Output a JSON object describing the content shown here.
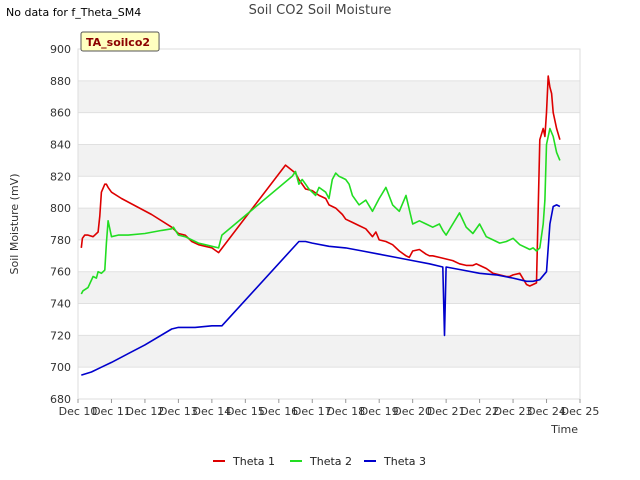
{
  "note": "No data for f_Theta_SM4",
  "chart_data": {
    "type": "line",
    "title": "Soil CO2 Soil Moisture",
    "xlabel": "Time",
    "ylabel": "Soil Moisture (mV)",
    "badge": "TA_soilco2",
    "xlim": [
      10,
      25
    ],
    "ylim": [
      680,
      900
    ],
    "x_ticks": [
      10,
      11,
      12,
      13,
      14,
      15,
      16,
      17,
      18,
      19,
      20,
      21,
      22,
      23,
      24,
      25
    ],
    "x_tick_labels": [
      "Dec 10",
      "Dec 11",
      "Dec 12",
      "Dec 13",
      "Dec 14",
      "Dec 15",
      "Dec 16",
      "Dec 17",
      "Dec 18",
      "Dec 19",
      "Dec 20",
      "Dec 21",
      "Dec 22",
      "Dec 23",
      "Dec 24",
      "Dec 25"
    ],
    "y_ticks": [
      680,
      700,
      720,
      740,
      760,
      780,
      800,
      820,
      840,
      860,
      880,
      900
    ],
    "y_tick_labels": [
      "680",
      "700",
      "720",
      "740",
      "760",
      "780",
      "800",
      "820",
      "840",
      "860",
      "880",
      "900"
    ],
    "grid": true,
    "legend_position": "bottom",
    "series": [
      {
        "name": "Theta 1",
        "color": "#dd0000",
        "x": [
          10.1,
          10.13,
          10.2,
          10.3,
          10.45,
          10.6,
          10.65,
          10.7,
          10.8,
          10.85,
          10.9,
          11.0,
          11.3,
          12.2,
          12.8,
          13.0,
          13.2,
          13.4,
          13.6,
          13.8,
          14.0,
          14.2,
          16.2,
          16.5,
          16.6,
          16.8,
          17.0,
          17.2,
          17.4,
          17.5,
          17.7,
          17.9,
          18.0,
          18.2,
          18.4,
          18.6,
          18.8,
          18.9,
          19.0,
          19.2,
          19.4,
          19.6,
          19.8,
          19.9,
          20.0,
          20.2,
          20.4,
          20.5,
          20.6,
          20.8,
          21.0,
          21.2,
          21.4,
          21.6,
          21.8,
          21.9,
          22.0,
          22.2,
          22.4,
          22.6,
          22.8,
          22.9,
          23.0,
          23.2,
          23.4,
          23.5,
          23.6,
          23.7,
          23.8,
          23.9,
          23.95,
          24.0,
          24.05,
          24.1,
          24.15,
          24.2,
          24.3,
          24.4
        ],
        "y": [
          775,
          781,
          783,
          783,
          782,
          785,
          795,
          810,
          815,
          815,
          813,
          810,
          806,
          796,
          788,
          784,
          783,
          779,
          777,
          776,
          775,
          772,
          827,
          822,
          818,
          812,
          811,
          808,
          806,
          802,
          800,
          796,
          793,
          791,
          789,
          787,
          782,
          785,
          780,
          779,
          777,
          773,
          770,
          769,
          773,
          774,
          771,
          770,
          770,
          769,
          768,
          767,
          765,
          764,
          764,
          765,
          764,
          762,
          759,
          758,
          757,
          757,
          758,
          759,
          752,
          751,
          752,
          753,
          843,
          850,
          845,
          860,
          883,
          876,
          872,
          860,
          850,
          843
        ]
      },
      {
        "name": "Theta 2",
        "color": "#22dd22",
        "x": [
          10.1,
          10.15,
          10.3,
          10.45,
          10.55,
          10.6,
          10.7,
          10.8,
          10.85,
          10.9,
          11.0,
          11.2,
          11.5,
          12.0,
          12.5,
          12.8,
          12.85,
          13.0,
          13.2,
          13.4,
          13.6,
          13.8,
          14.0,
          14.2,
          14.3,
          16.4,
          16.5,
          16.6,
          16.7,
          16.8,
          16.9,
          17.0,
          17.1,
          17.2,
          17.4,
          17.5,
          17.6,
          17.7,
          17.8,
          17.9,
          18.0,
          18.1,
          18.2,
          18.4,
          18.6,
          18.8,
          19.0,
          19.2,
          19.4,
          19.6,
          19.8,
          20.0,
          20.2,
          20.4,
          20.6,
          20.8,
          20.9,
          21.0,
          21.2,
          21.4,
          21.6,
          21.8,
          22.0,
          22.2,
          22.4,
          22.6,
          22.8,
          23.0,
          23.2,
          23.4,
          23.5,
          23.6,
          23.7,
          23.8,
          23.9,
          23.95,
          24.0,
          24.1,
          24.2,
          24.3,
          24.4
        ],
        "y": [
          746,
          748,
          750,
          757,
          756,
          760,
          759,
          761,
          778,
          792,
          782,
          783,
          783,
          784,
          786,
          787,
          788,
          783,
          782,
          780,
          778,
          777,
          776,
          775,
          783,
          820,
          823,
          815,
          818,
          815,
          812,
          810,
          808,
          813,
          810,
          806,
          818,
          822,
          820,
          819,
          818,
          815,
          808,
          802,
          805,
          798,
          806,
          813,
          802,
          798,
          808,
          790,
          792,
          790,
          788,
          790,
          786,
          783,
          790,
          797,
          788,
          784,
          790,
          782,
          780,
          778,
          779,
          781,
          777,
          775,
          774,
          775,
          773,
          775,
          790,
          805,
          840,
          850,
          845,
          835,
          830
        ]
      },
      {
        "name": "Theta 3",
        "color": "#0000cc",
        "x": [
          10.1,
          10.4,
          10.7,
          11.0,
          12.0,
          12.8,
          13.0,
          13.5,
          14.0,
          14.3,
          16.6,
          16.8,
          17.0,
          17.5,
          18.0,
          18.5,
          19.0,
          19.5,
          20.0,
          20.5,
          20.9,
          20.95,
          21.0,
          21.5,
          22.0,
          22.5,
          23.0,
          23.4,
          23.6,
          23.8,
          24.0,
          24.1,
          24.2,
          24.3,
          24.4
        ],
        "y": [
          695,
          697,
          700,
          703,
          714,
          724,
          725,
          725,
          726,
          726,
          779,
          779,
          778,
          776,
          775,
          773,
          771,
          769,
          767,
          765,
          763,
          720,
          763,
          761,
          759,
          758,
          756,
          754,
          754,
          755,
          760,
          790,
          801,
          802,
          801
        ]
      }
    ]
  }
}
